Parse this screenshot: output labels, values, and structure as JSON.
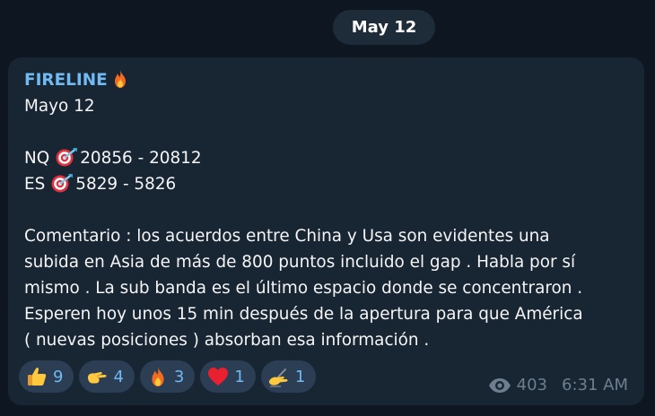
{
  "date_separator": "May 12",
  "message": {
    "sender": "FIRELINE",
    "sender_emoji": "fire-emoji",
    "date_line": "Mayo 12",
    "quotes": [
      {
        "symbol": "NQ",
        "emoji": "target-emoji",
        "range": "20856 - 20812"
      },
      {
        "symbol": "ES",
        "emoji": "target-emoji",
        "range": "5829 - 5826"
      }
    ],
    "comment_lines": [
      "Comentario : los acuerdos entre China  y Usa son evidentes una",
      "subida en Asia de más de 800 puntos incluido el gap . Habla por sí",
      "mismo . La sub banda es el último espacio donde se concentraron .",
      "Esperen hoy unos 15 min después de la apertura para que América",
      "( nuevas posiciones ) absorban esa información ."
    ],
    "reactions": [
      {
        "emoji": "thumbs-up-emoji",
        "count": "9"
      },
      {
        "emoji": "pinching-hand-emoji",
        "count": "4"
      },
      {
        "emoji": "fire-emoji",
        "count": "3"
      },
      {
        "emoji": "red-heart-emoji",
        "count": "1"
      },
      {
        "emoji": "writing-hand-emoji",
        "count": "1"
      }
    ],
    "views": "403",
    "time": "6:31 AM"
  },
  "colors": {
    "background": "#0e1621",
    "bubble": "#182533",
    "sender": "#71baf2",
    "reaction_chip": "#2b3e53",
    "meta": "#6d7f8f"
  }
}
